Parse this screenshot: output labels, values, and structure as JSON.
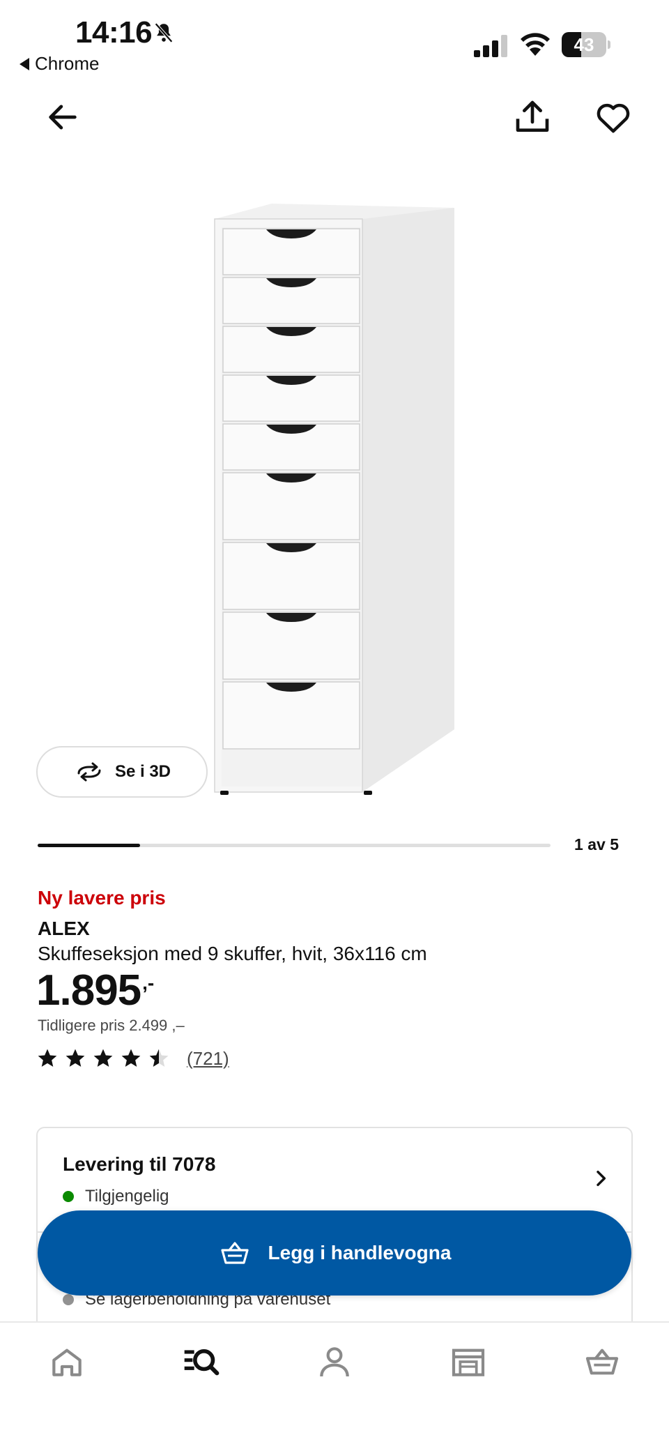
{
  "status_bar": {
    "time": "14:16",
    "back_app_label": "Chrome",
    "battery_level": "43",
    "battery_fraction": 0.43
  },
  "nav": {
    "back_icon": "arrow-left-icon",
    "share_icon": "share-icon",
    "favorite_icon": "heart-icon"
  },
  "gallery": {
    "view_3d_label": "Se i 3D",
    "page_indicator": "1 av 5",
    "current_page": 1,
    "total_pages": 5
  },
  "product": {
    "badge": "Ny lavere pris",
    "name": "ALEX",
    "description": "Skuffeseksjon med 9 skuffer, hvit, 36x116 cm",
    "price": "1.895",
    "price_suffix": ",-",
    "previous_price": "Tidligere pris 2.499 ,–",
    "rating": 4.5,
    "rating_max": 5,
    "review_count": "(721)"
  },
  "availability": {
    "delivery_title": "Levering til 7078",
    "delivery_status": "Tilgjengelig",
    "delivery_status_color": "#0a8a00",
    "store_status": "Se lagerbeholdning på varehuset",
    "store_status_color": "#929292"
  },
  "cart_button": {
    "label": "Legg i handlevogna",
    "color": "#0058a3"
  },
  "tab_bar": {
    "items": [
      "home-icon",
      "search-icon",
      "profile-icon",
      "store-icon",
      "basket-icon"
    ],
    "active": "search-icon"
  },
  "colors": {
    "accent": "#0058a3",
    "sale_red": "#cc0008"
  }
}
